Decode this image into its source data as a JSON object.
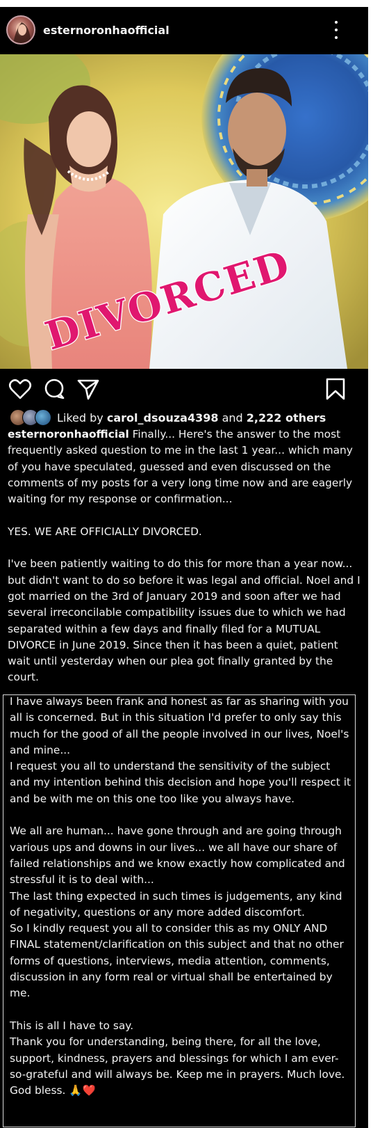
{
  "post": {
    "username": "esternoronhaofficial",
    "image_overlay_text": "DIVORCED"
  },
  "icons": {
    "avatar": "profile-avatar",
    "more": "more-vertical-icon",
    "like": "heart-icon",
    "comment": "comment-icon",
    "share": "send-icon",
    "save": "bookmark-icon"
  },
  "likes": {
    "prefix": "Liked by ",
    "user": "carol_dsouza4398",
    "middle": " and ",
    "others": "2,222 others"
  },
  "caption": {
    "username": "esternoronhaofficial",
    "text": " Finally... Here's the answer to the most frequently asked question to me in the last 1 year... which many of you have speculated, guessed and even discussed on the comments of my posts for a very long time now and are eagerly waiting for my response or confirmation...\n\nYES. WE ARE OFFICIALLY DIVORCED.\n\nI've been patiently waiting to do this for more than a year now... but didn't want to do so before it was legal and official. Noel and I got married on the 3rd of January 2019 and soon after we had several irreconcilable compatibility issues due to which we had separated within a few days and finally filed for a MUTUAL DIVORCE in June 2019. Since then it has been a quiet, patient wait until yesterday when our plea got finally granted by the court.",
    "continued": "I have always been frank and honest as far as sharing with you all is concerned. But in this situation I'd prefer to only say this much for the good of all the people involved in our lives, Noel's and mine...\nI request you all to understand the sensitivity of the subject and my intention behind this decision and hope you'll respect it and be with me on this one too like you always have.\n\nWe all are human... have gone through and are going through various ups and downs in our lives... we all have our share of failed relationships and we know exactly how complicated and stressful it is to deal with...\nThe last thing expected in such times is judgements, any kind of negativity, questions or any more added discomfort.\nSo I kindly request you all to consider this as my ONLY AND FINAL statement/clarification on this subject and that no other forms of questions, interviews, media attention, comments, discussion in any form real or virtual shall be entertained by me.\n\nThis is all I have to say.\nThank you for understanding, being there, for all the love, support, kindness, prayers and blessings for which I am ever-so-grateful and will always be. Keep me in prayers. Much love. God bless. 🙏❤️"
  },
  "colors": {
    "background": "#000000",
    "overlay_text": "#e0176f",
    "text": "#f2f2f2"
  }
}
